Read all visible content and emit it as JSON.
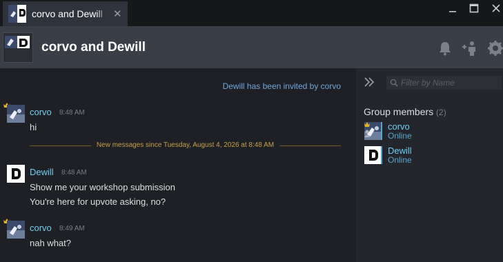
{
  "window": {
    "tab_title": "corvo and Dewill",
    "tab_close": "✕",
    "controls": [
      "minimize",
      "maximize",
      "close"
    ]
  },
  "header": {
    "title": "corvo and Dewill",
    "icons": [
      "bell-icon",
      "add-friend-icon",
      "settings-icon"
    ]
  },
  "chat": {
    "system_message": "Dewill has been invited by corvo",
    "new_messages_divider": "New messages since Tuesday, August 4, 2026 at 8:48 AM",
    "messages": [
      {
        "author": "corvo",
        "time": "8:48 AM",
        "lines": [
          "hi"
        ]
      },
      {
        "author": "Dewill",
        "time": "8:48 AM",
        "lines": [
          "Show me your workshop submission",
          "You're here for upvote asking, no?"
        ]
      },
      {
        "author": "corvo",
        "time": "8:49 AM",
        "lines": [
          "nah what?"
        ]
      }
    ]
  },
  "members_panel": {
    "filter_placeholder": "Filter by Name",
    "heading": "Group members",
    "count": "(2)",
    "members": [
      {
        "name": "corvo",
        "status": "Online"
      },
      {
        "name": "Dewill",
        "status": "Online"
      }
    ]
  },
  "colors": {
    "username": "#6dcff6",
    "system_link": "#6fa8dc",
    "divider": "#c9a046",
    "background": "#1e2025",
    "header": "#3a3e47"
  }
}
